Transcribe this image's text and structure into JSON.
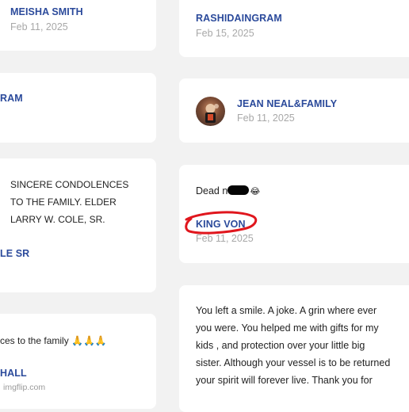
{
  "left_column": {
    "card1": {
      "name": "MEISHA SMITH",
      "date": "Feb 11, 2025"
    },
    "card2": {
      "name_fragment": "RAM"
    },
    "card3": {
      "message_lines": [
        "SINCERE CONDOLENCES",
        "TO THE FAMILY. ELDER",
        "LARRY W. COLE, SR."
      ],
      "name_fragment": "LE SR"
    },
    "card4": {
      "message": "ces to the family 🙏🙏🙏",
      "name_fragment": "HALL"
    }
  },
  "right_column": {
    "card1": {
      "name": "RASHIDAINGRAM",
      "date": "Feb 15, 2025"
    },
    "card2": {
      "name": "JEAN NEAL&FAMILY",
      "date": "Feb 11, 2025"
    },
    "card3": {
      "message_prefix": "Dead n",
      "message_emoji": "😂",
      "name": "KING VON",
      "date": "Feb 11, 2025"
    },
    "card4": {
      "message_lines": [
        "You left a smile. A joke.  A grin where ever",
        "you were. You helped me with gifts for my",
        "kids , and protection over your little big",
        "sister. Although your vessel is to be returned",
        "your spirit will forever live.  Thank you for"
      ]
    }
  },
  "watermark": "imgflip.com",
  "colors": {
    "background": "#f2f2f2",
    "card": "#ffffff",
    "name": "#2b4a9b",
    "date": "#a8a8a8",
    "text": "#222222",
    "annotation": "#e0161d"
  }
}
